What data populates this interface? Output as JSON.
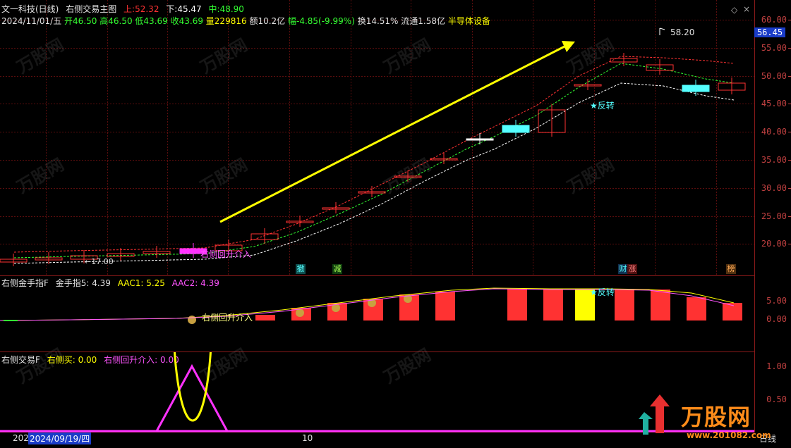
{
  "header": {
    "stock_name": "文一科技(日线)",
    "indicator": "右侧交易主图",
    "upper_label": "上:",
    "upper_value": "52.32",
    "lower_label": "下:",
    "lower_value": "45.47",
    "mid_label": "中:",
    "mid_value": "48.90",
    "date": "2024/11/01/五",
    "open": "开46.50",
    "high": "高46.50",
    "low": "低43.69",
    "close": "收43.69",
    "volume": "量229816",
    "amount": "额10.2亿",
    "change": "幅-4.85(-9.99%)",
    "turnover": "换14.51%",
    "float": "流通1.58亿",
    "sector": "半导体设备"
  },
  "main_chart": {
    "price_ticks": [
      "60.00",
      "55.00",
      "50.00",
      "45.00",
      "40.00",
      "35.00",
      "30.00",
      "25.00",
      "20.00"
    ],
    "current_price": "56.45",
    "high_marker": "58.20",
    "low_marker": "←17.00",
    "labels": {
      "reversal": "★反转",
      "entry": "右侧回升介入"
    },
    "event_tags": [
      "撤",
      "减",
      "财",
      "涨",
      "榜"
    ],
    "colors": {
      "up": "#ff3232",
      "down": "#54ffff",
      "upper_band": "#ff3232",
      "mid_band": "#32ff32",
      "lower_band": "#ffffff",
      "arrow": "#ffff00",
      "circle": "#ffff00"
    }
  },
  "panel2": {
    "title": "右侧金手指F",
    "legend1": "金手指5: 4.39",
    "legend2": "AAC1: 5.25",
    "legend3": "AAC2: 4.39",
    "ticks": [
      "5.00",
      "0.00"
    ],
    "entry_label": "右侧回升介入",
    "reversal_label": "★反转",
    "coin_icon": "money-bag"
  },
  "panel3": {
    "title": "右侧交易F",
    "legend1": "右侧买: 0.00",
    "legend2": "右侧回升介入: 0.00",
    "ticks": [
      "1.00",
      "0.50",
      "0.00"
    ]
  },
  "footer": {
    "left_date": "202",
    "cursor_date": "2024/09/19/四",
    "mid_label": "10",
    "period": "日线",
    "logo": "万股网",
    "logo_url": "www.201082.com"
  }
}
